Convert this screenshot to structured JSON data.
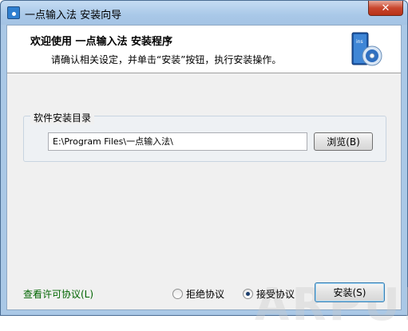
{
  "window": {
    "title": "一点输入法 安装向导",
    "close_glyph": "✕"
  },
  "header": {
    "title": "欢迎使用  一点输入法  安装程序",
    "subtitle": "请确认相关设定，并单击“安装”按钮，执行安装操作。",
    "icon_label": "ins"
  },
  "install_dir": {
    "group_label": "软件安装目录",
    "path_value": "E:\\Program Files\\一点输入法\\",
    "browse_label": "浏览(B)"
  },
  "footer": {
    "license_link": "查看许可协议(L)",
    "decline_label": "拒绝协议",
    "accept_label": "接受协议",
    "selected": "accept",
    "install_label": "安装(S)"
  },
  "watermark": "ARPUN",
  "colors": {
    "link": "#006400",
    "header_bg": "#ffffff",
    "client_bg": "#f0f0f0"
  }
}
